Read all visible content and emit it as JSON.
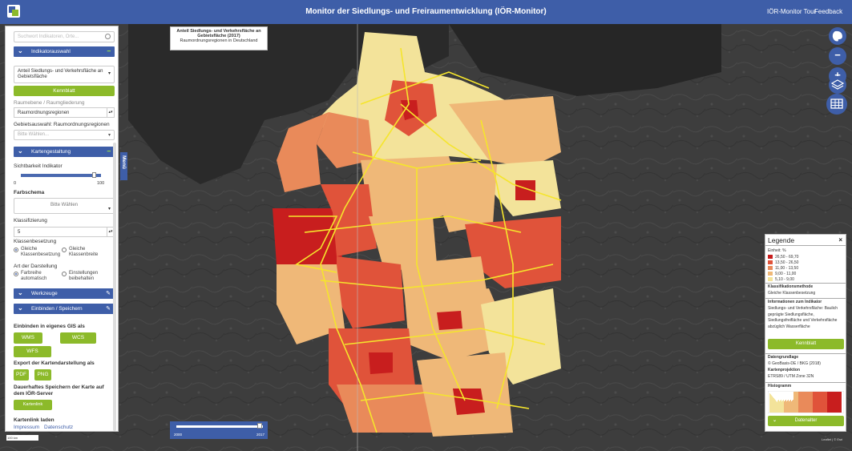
{
  "header": {
    "title": "Monitor der Siedlungs- und Freiraumentwicklung (IÖR-Monitor)",
    "tour_label": "IÖR-Monitor Tour",
    "feedback_label": "Feedback"
  },
  "sidebar": {
    "search_placeholder": "Suchwort Indikatoren, Orte...",
    "indikator_section": "Indikatorauswahl",
    "indikator_selected": "Anteil Siedlungs- und Verkehrsfläche an Gebietsfläche",
    "kennblatt_label": "Kennblatt",
    "cut_label": "Raumebene / Raumgliederung",
    "raumebene_selected": "Raumordnungsregionen",
    "gebietsauswahl_label": "Gebietsauswahl: Raumordnungsregionen",
    "gebietsauswahl_placeholder": "Bitte Wählen...",
    "karten_section": "Kartengestaltung",
    "sichtbarkeit_label": "Sichtbarkeit Indikator",
    "slider_value": 0.92,
    "slider_min": "0",
    "slider_max": "100",
    "farbschema_label": "Farbschema",
    "farbschema_value": "Bitte Wählen",
    "klassifizierung_label": "Klassifizierung",
    "klassifizierung_value": "5",
    "klassenbesetzung_label": "Klassenbesetzung",
    "radio_gleiche_besetzung": "Gleiche Klassenbesetzung",
    "radio_gleiche_breite": "Gleiche Klassenbreite",
    "darstellung_label": "Art der Darstellung",
    "radio_farbreihe": "Farbreihe automatisch",
    "radio_einstellungen": "Einstellungen beibehalten",
    "werkzeuge_section": "Werkzeuge",
    "einbinden_section": "Einbinden / Speichern",
    "einbinden_gis_label": "Einbinden in eigenes GIS als",
    "wms_label": "WMS",
    "wcs_label": "WCS",
    "wfs_label": "WFS",
    "export_label": "Export der Kartendarstellung als",
    "pdf_label": "PDF",
    "png_label": "PNG",
    "speichern_label": "Dauerhaftes Speichern der Karte auf dem IÖR-Server",
    "kartenlink_btn": "Kartenlink erzeugen",
    "kartenlink_laden": "Kartenlink laden",
    "impressum": "Impressum",
    "datenschutz": "Datenschutz"
  },
  "menu_tab": "Menü",
  "map_title": {
    "line1": "Anteil Siedlungs- und Verkehrsfläche an",
    "line2": "Gebietsfläche (2017)",
    "line3": "Raumordnungsregionen in Deutschland"
  },
  "timeline": {
    "start": "2000",
    "end": "2017",
    "position": 0.96
  },
  "map_controls": {
    "zoom_in": "+",
    "zoom_out": "−"
  },
  "legend": {
    "title": "Legende",
    "unit": "Einheit: %",
    "classes": [
      {
        "label": "26,50 - 69,70",
        "color": "#c81e1e"
      },
      {
        "label": "13,50 - 26,50",
        "color": "#e0533a"
      },
      {
        "label": "11,00 - 13,50",
        "color": "#e98a5a"
      },
      {
        "label": "9,00 - 11,00",
        "color": "#efb878"
      },
      {
        "label": "5,10 - 9,00",
        "color": "#f3e39a"
      }
    ],
    "klassifikation_head": "Klassifikationsmethode",
    "klassifikation_value": "Gleiche Klassenbesetzung",
    "info_head": "Informationen zum Indikator",
    "info_text": "Siedlungs- und Verkehrsfläche: Baulich geprägte Siedlungsfläche, Siedlungsfreifläche und Verkehrsfläche abzüglich Wasserfläche",
    "kennblatt_btn": "Kennblatt",
    "datengrundlage_head": "Datengrundlage",
    "datengrundlage_value": "© GeoBasis-DE / BKG (2018)",
    "projektion_head": "Kartenprojektion",
    "projektion_value": "ETRS89 / UTM Zone 32N",
    "histogramm_head": "Histogramm",
    "datenalter_btn": "Datenalter"
  },
  "scale": "100 km",
  "attribution": "Leaflet | © Esri"
}
